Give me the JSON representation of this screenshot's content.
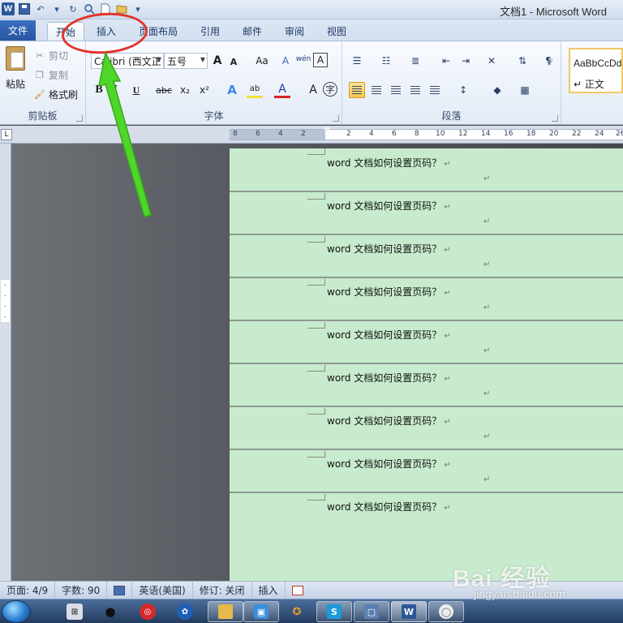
{
  "window": {
    "title": "文档1 - Microsoft Word"
  },
  "quick_access": {
    "undo_glyph": "↶",
    "redo_glyph": "↻",
    "dropdown_glyph": "▾"
  },
  "tabs": {
    "file": "文件",
    "items": [
      {
        "label": "开始",
        "active": true
      },
      {
        "label": "插入",
        "active": false
      },
      {
        "label": "页面布局",
        "active": false
      },
      {
        "label": "引用",
        "active": false
      },
      {
        "label": "邮件",
        "active": false
      },
      {
        "label": "审阅",
        "active": false
      },
      {
        "label": "视图",
        "active": false
      }
    ]
  },
  "ribbon": {
    "clipboard": {
      "paste": "粘贴",
      "cut": "剪切",
      "copy": "复制",
      "format_painter": "格式刷",
      "group_label": "剪贴板"
    },
    "font": {
      "font_name": "Calibri (西文正",
      "font_size": "五号",
      "grow": "A",
      "shrink": "A",
      "case": "Aa",
      "clear": "A",
      "bold": "B",
      "italic": "I",
      "underline": "U",
      "strike": "abc",
      "subscript": "x₂",
      "superscript": "x²",
      "effects": "A",
      "highlight": "ab",
      "color": "A",
      "charshade": "A",
      "enclose": "字",
      "pinyin": "wén",
      "border": "A",
      "group_label": "字体"
    },
    "paragraph": {
      "group_label": "段落"
    },
    "styles": {
      "sample": "AaBbCcDd",
      "name": "↵ 正文"
    }
  },
  "ruler": {
    "ticks": [
      "8",
      "6",
      "4",
      "2",
      "2",
      "4",
      "6",
      "8",
      "10",
      "12",
      "14",
      "16",
      "18",
      "20",
      "22",
      "24",
      "26"
    ]
  },
  "document": {
    "lines": [
      "word 文档如何设置页码？",
      "word 文档如何设置页码？",
      "word 文档如何设置页码？",
      "word 文档如何设置页码？",
      "word 文档如何设置页码？",
      "word 文档如何设置页码？",
      "word 文档如何设置页码？",
      "word 文档如何设置页码？",
      "word 文档如何设置页码？"
    ],
    "para_mark": "↵"
  },
  "status": {
    "page": "页面: 4/9",
    "words": "字数: 90",
    "language": "英语(美国)",
    "track": "修订: 关闭",
    "mode": "插入"
  },
  "watermark": {
    "main": "Bai 经验",
    "sub": "jingyan.baidu.com"
  },
  "colors": {
    "page_bg": "#c7ebcc",
    "accent": "#2b5797",
    "annotation_red": "#e2332b",
    "annotation_green": "#4fd62a"
  }
}
